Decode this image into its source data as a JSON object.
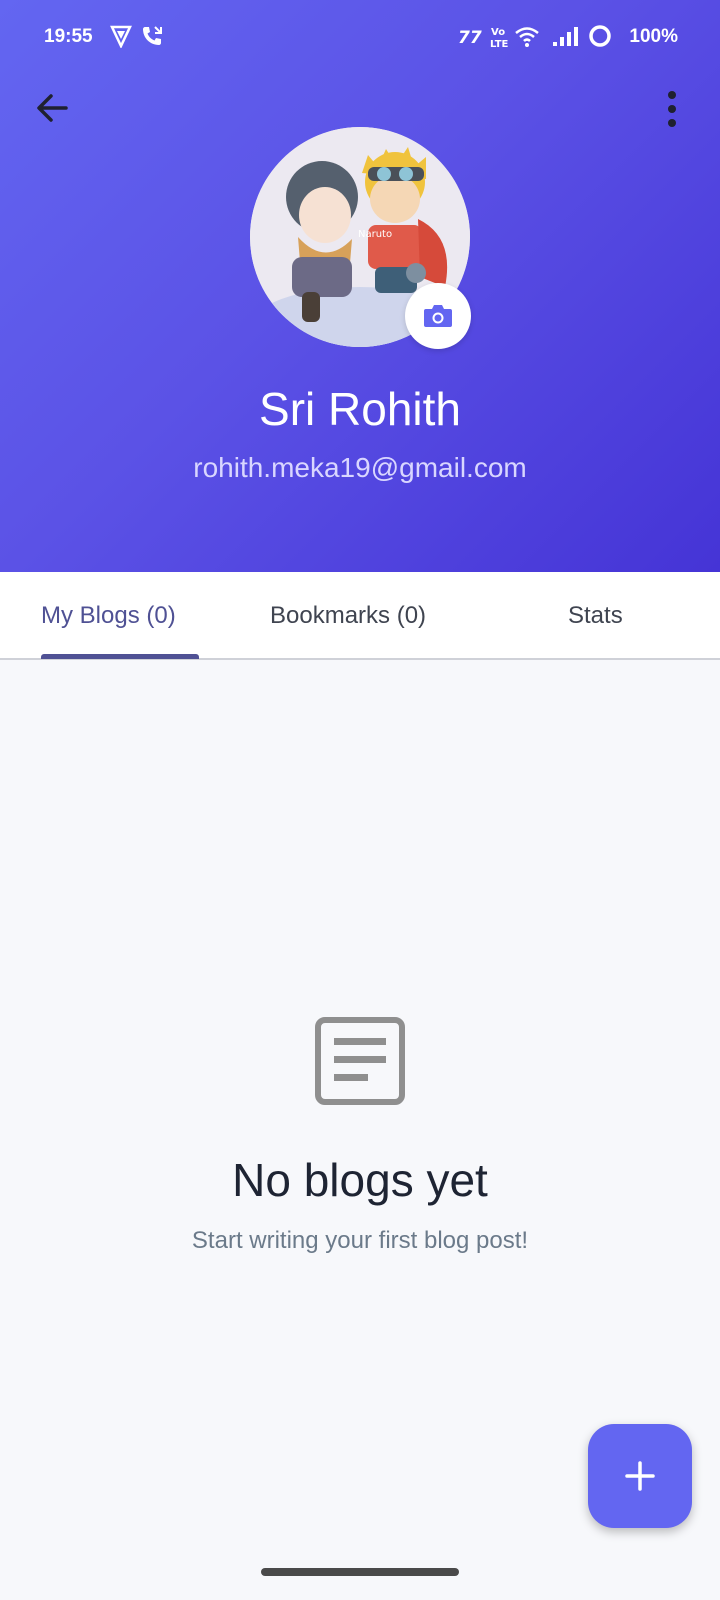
{
  "status_bar": {
    "time": "19:55",
    "battery": "100%",
    "icons": [
      "shield-icon",
      "call-icon",
      "carrier-icon",
      "volte-icon",
      "wifi-icon",
      "signal-icon",
      "battery-ring-icon"
    ]
  },
  "header": {
    "back_icon": "back-arrow-icon",
    "menu_icon": "more-vertical-icon",
    "profile_name": "Sri Rohith",
    "profile_email": "rohith.meka19@gmail.com",
    "camera_icon": "camera-icon",
    "gradient": [
      "#6366f1",
      "#4534d6"
    ]
  },
  "tabs": [
    {
      "label": "My Blogs (0)",
      "active": true
    },
    {
      "label": "Bookmarks (0)",
      "active": false
    },
    {
      "label": "Stats",
      "active": false
    }
  ],
  "empty_state": {
    "icon": "article-icon",
    "title": "No blogs yet",
    "subtitle": "Start writing your first blog post!"
  },
  "fab": {
    "icon": "plus-icon"
  },
  "colors": {
    "accent": "#6366f1",
    "tab_active": "#4f5194",
    "background": "#f7f8fb"
  }
}
